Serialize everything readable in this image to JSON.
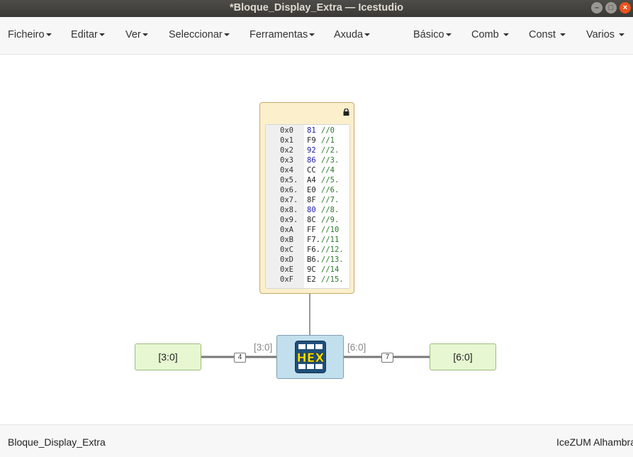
{
  "window": {
    "title": "*Bloque_Display_Extra — Icestudio",
    "minimize_icon": "–",
    "maximize_icon": "□",
    "close_icon": "×"
  },
  "menubar": {
    "left": [
      "Ficheiro",
      "Editar",
      "Ver",
      "Seleccionar",
      "Ferramentas",
      "Axuda"
    ],
    "right": [
      "Básico",
      "Comb",
      "Const",
      "Varios"
    ]
  },
  "memory_block": {
    "rows": [
      {
        "addr": "0x0",
        "value": "81",
        "comment": "//0"
      },
      {
        "addr": "0x1",
        "value": "F9",
        "comment": "//1"
      },
      {
        "addr": "0x2",
        "value": "92",
        "comment": "//2."
      },
      {
        "addr": "0x3",
        "value": "86",
        "comment": "//3."
      },
      {
        "addr": "0x4",
        "value": "CC",
        "comment": "//4"
      },
      {
        "addr": "0x5.",
        "value": "A4",
        "comment": "//5."
      },
      {
        "addr": "0x6.",
        "value": "E0",
        "comment": "//6."
      },
      {
        "addr": "0x7.",
        "value": "8F",
        "comment": "//7."
      },
      {
        "addr": "0x8.",
        "value": "80",
        "comment": "//8."
      },
      {
        "addr": "0x9.",
        "value": "8C",
        "comment": "//9."
      },
      {
        "addr": "0xA",
        "value": "FF",
        "comment": "//10"
      },
      {
        "addr": "0xB",
        "value": "F7.",
        "comment": "//11"
      },
      {
        "addr": "0xC",
        "value": "F6.",
        "comment": "//12."
      },
      {
        "addr": "0xD",
        "value": "B6.",
        "comment": "//13."
      },
      {
        "addr": "0xE",
        "value": "9C",
        "comment": "//14"
      },
      {
        "addr": "0xF",
        "value": "E2",
        "comment": "//15."
      }
    ]
  },
  "input_port": {
    "label": "[3:0]"
  },
  "output_port": {
    "label": "[6:0]"
  },
  "hex_block": {
    "icon_text": "HEX",
    "input_label": "[3:0]",
    "output_label": "[6:0]"
  },
  "wires": {
    "input_width": "4",
    "output_width": "7"
  },
  "footer": {
    "project": "Bloque_Display_Extra",
    "board": "IceZUM Alhambra"
  },
  "colors": {
    "titlebar": "#3c3b37",
    "close_button": "#e9541e",
    "memory_block": "#fbefcc",
    "io_block": "#e6f7d1",
    "hex_block": "#c2dfee",
    "hex_text": "#ffe600"
  }
}
